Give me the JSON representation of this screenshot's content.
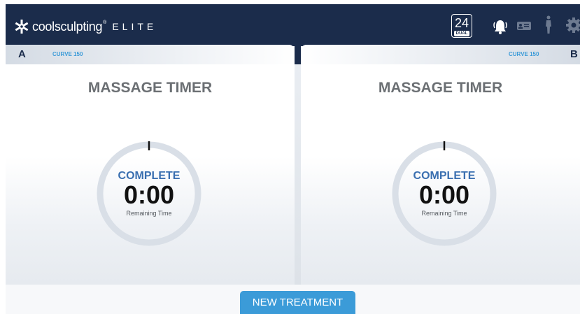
{
  "header": {
    "brand": "coolsculpting",
    "brand_mark": "®",
    "product": "ELITE",
    "session_number": "24",
    "session_mode": "DUAL",
    "icons": [
      "alarm-bell-icon",
      "id-card-icon",
      "body-figure-icon",
      "gear-icon"
    ]
  },
  "panels": [
    {
      "side": "A",
      "applicator": "CURVE 150",
      "title": "MASSAGE TIMER",
      "status": "COMPLETE",
      "time": "0:00",
      "time_label": "Remaining Time",
      "progress_remaining": 0
    },
    {
      "side": "B",
      "applicator": "CURVE 150",
      "title": "MASSAGE TIMER",
      "status": "COMPLETE",
      "time": "0:00",
      "time_label": "Remaining Time",
      "progress_remaining": 0
    }
  ],
  "actions": {
    "new_treatment": "NEW TREATMENT"
  },
  "colors": {
    "navy": "#1b2c4b",
    "accent_blue": "#3b9bd8",
    "status_blue": "#3a6fb0",
    "ring_gray": "#d9dfe7"
  }
}
